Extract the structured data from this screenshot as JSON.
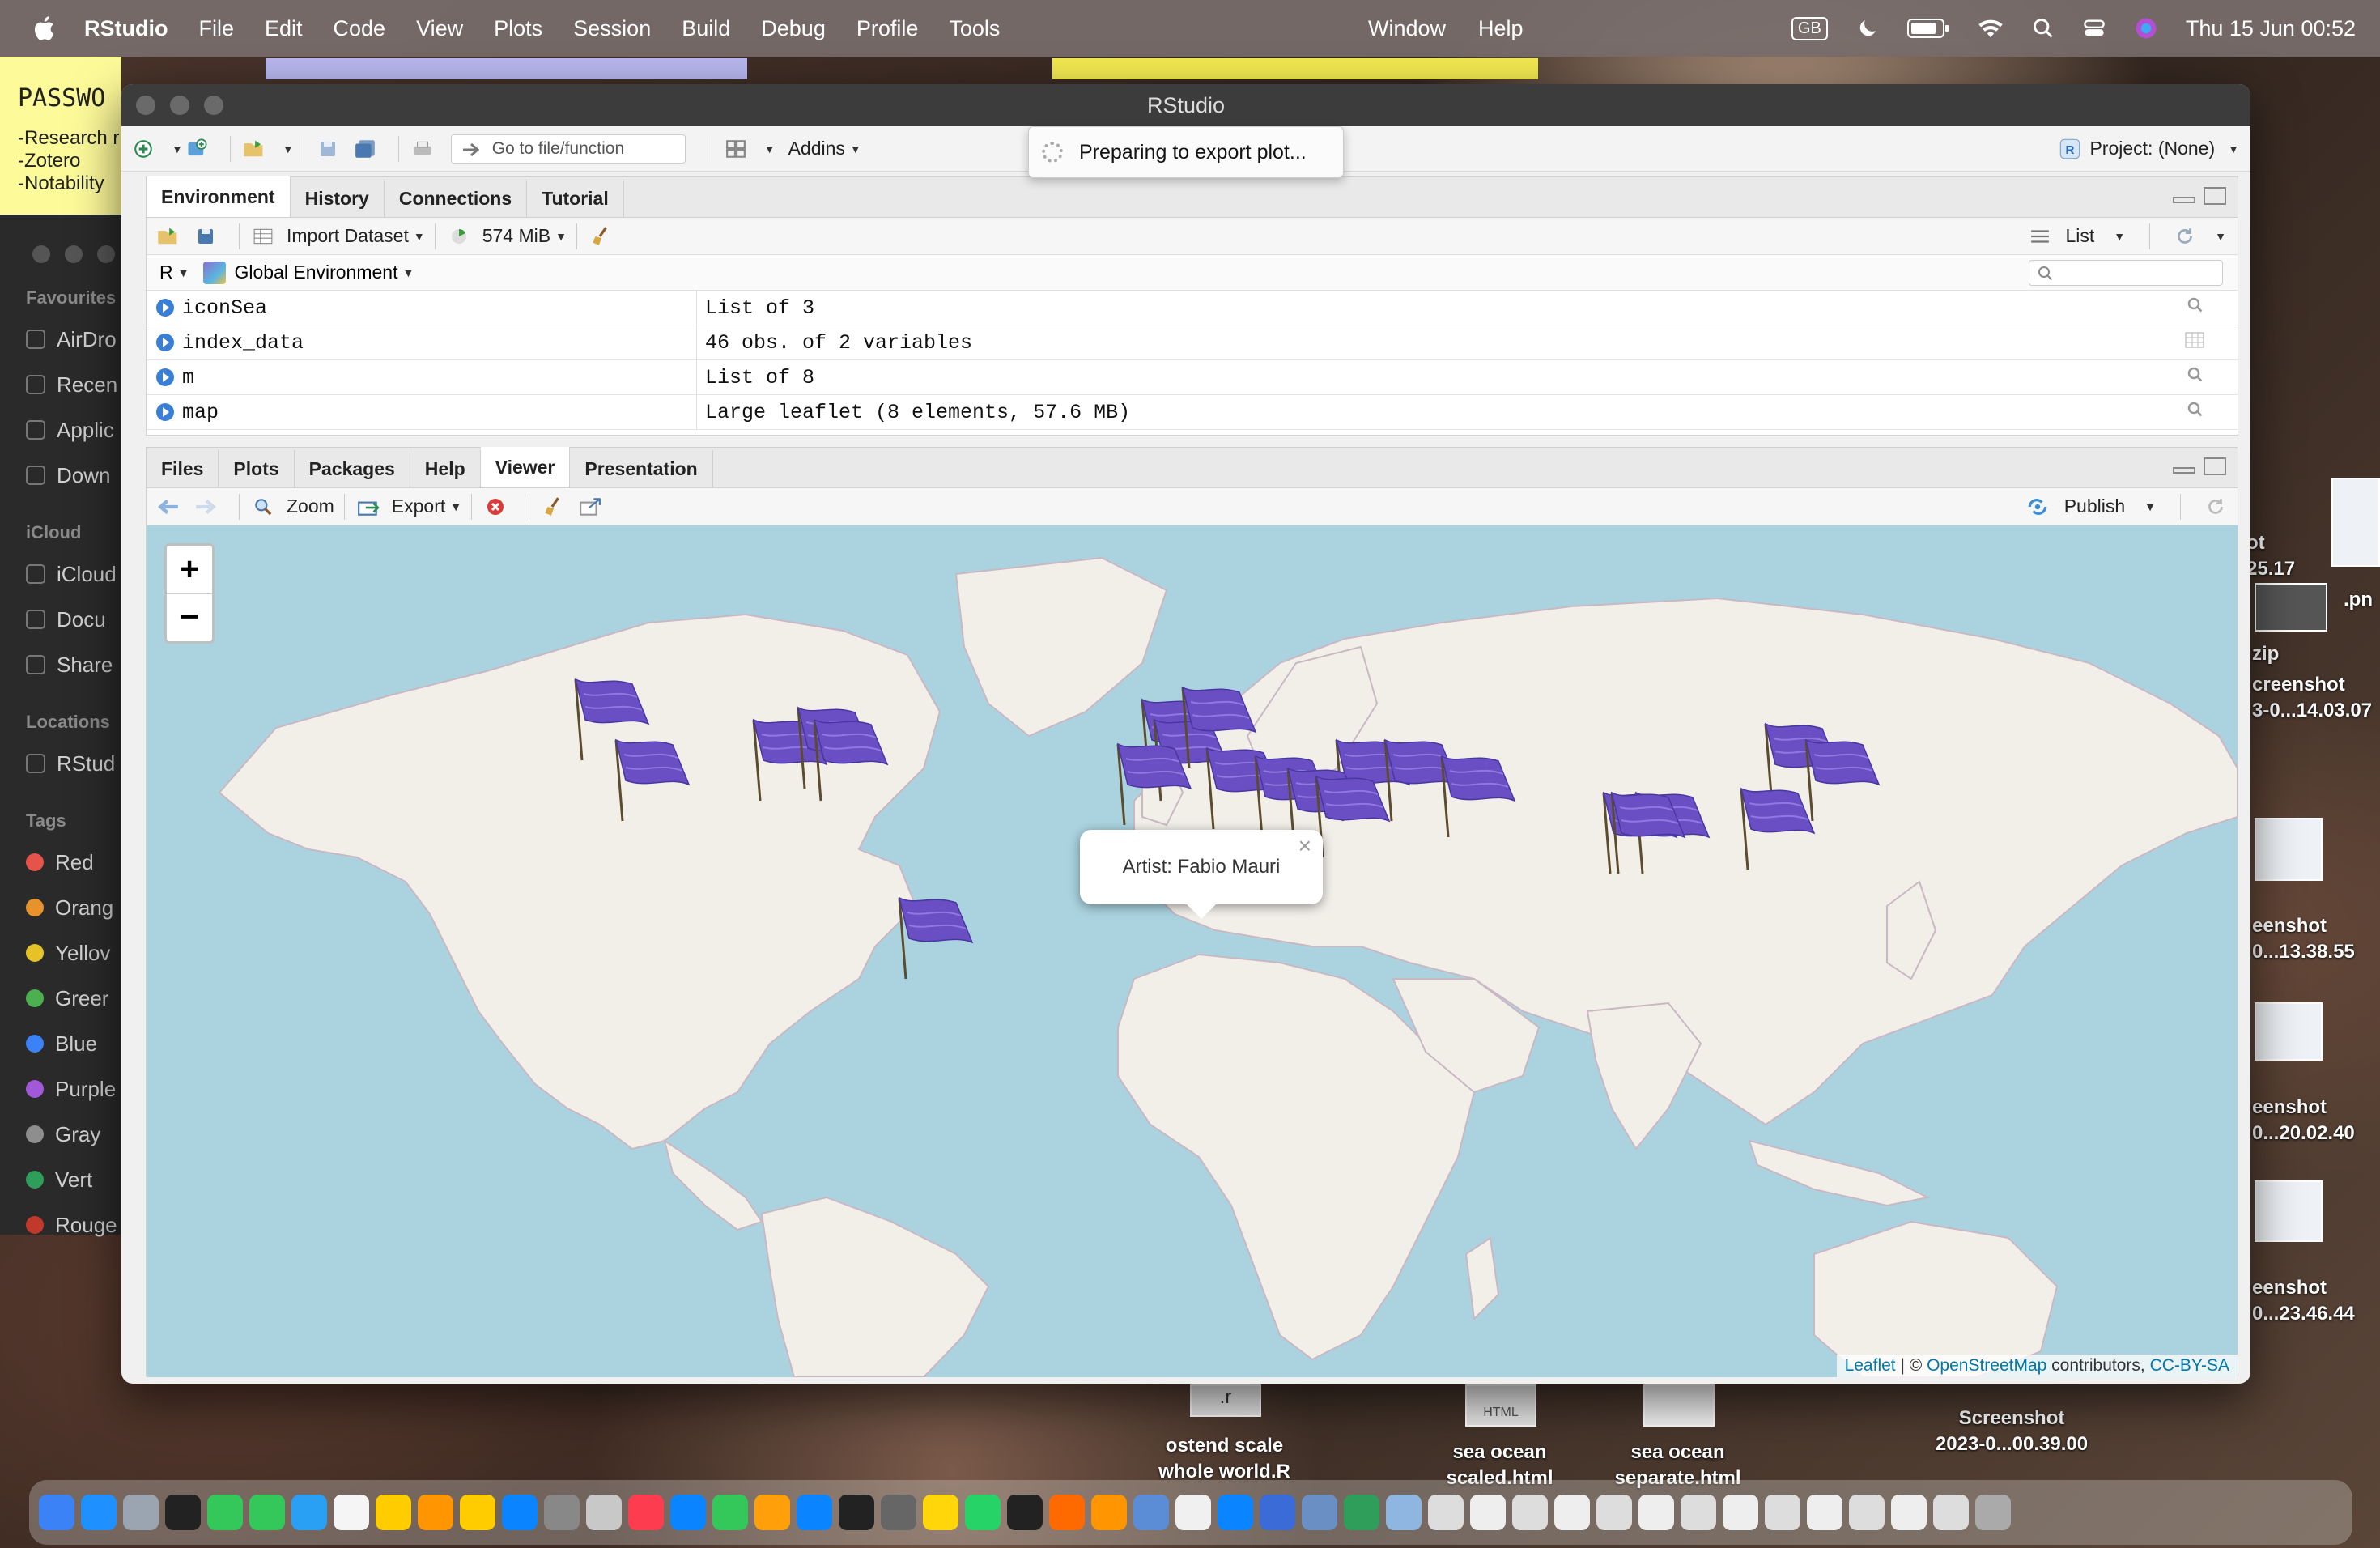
{
  "menubar": {
    "app": "RStudio",
    "items": [
      "File",
      "Edit",
      "Code",
      "View",
      "Plots",
      "Session",
      "Build",
      "Debug",
      "Profile",
      "Tools"
    ],
    "right_items": [
      "Window",
      "Help"
    ],
    "input_source": "GB",
    "datetime": "Thu 15 Jun  00:52"
  },
  "sticky": {
    "title": "PASSWO",
    "lines": [
      "-Research r",
      "-Zotero",
      "-Notability"
    ]
  },
  "finder": {
    "favourites_label": "Favourites",
    "favourites": [
      "AirDro",
      "Recen",
      "Applic",
      "Down"
    ],
    "icloud_label": "iCloud",
    "icloud": [
      "iCloud",
      "Docu",
      "Share"
    ],
    "locations_label": "Locations",
    "locations": [
      "RStud"
    ],
    "tags_label": "Tags",
    "tags": [
      {
        "label": "Red",
        "color": "#e5534b"
      },
      {
        "label": "Orang",
        "color": "#e8922e"
      },
      {
        "label": "Yellov",
        "color": "#e6c229"
      },
      {
        "label": "Greer",
        "color": "#4caf50"
      },
      {
        "label": "Blue",
        "color": "#3b82f6"
      },
      {
        "label": "Purple",
        "color": "#a259d9"
      },
      {
        "label": "Gray",
        "color": "#8e8e8e"
      },
      {
        "label": "Vert",
        "color": "#2e9e5a"
      },
      {
        "label": "Rouge",
        "color": "#c0392b"
      }
    ]
  },
  "desktop": {
    "right_labels": [
      {
        "l1": "ot",
        "l2": "25.17"
      },
      {
        "l1": "zip",
        "l2": ""
      },
      {
        "l1": "creenshot",
        "l2": "3-0...14.03.07"
      },
      {
        "l1": "eenshot",
        "l2": "0...13.38.55"
      },
      {
        "l1": "eenshot",
        "l2": "0...20.02.40"
      },
      {
        "l1": "eenshot",
        "l2": "0...23.46.44"
      },
      {
        "l1": ".pn",
        "l2": ""
      }
    ],
    "bottom_files": [
      {
        "badge": ".r",
        "l1": "ostend scale",
        "l2": "whole world.R"
      },
      {
        "badge": "HTML",
        "l1": "sea ocean",
        "l2": "scaled.html"
      },
      {
        "badge": "",
        "l1": "sea ocean",
        "l2": "separate.html"
      },
      {
        "badge": "",
        "l1": "Screenshot",
        "l2": "2023-0...00.39.00"
      }
    ]
  },
  "window": {
    "title": "RStudio"
  },
  "toolbar": {
    "goto_placeholder": "Go to file/function",
    "addins_label": "Addins",
    "project_label": "Project: (None)"
  },
  "export_popup": {
    "text": "Preparing to export plot..."
  },
  "env_pane": {
    "tabs": [
      "Environment",
      "History",
      "Connections",
      "Tutorial"
    ],
    "active_tab": "Environment",
    "import_label": "Import Dataset",
    "memory_label": "574 MiB",
    "list_label": "List",
    "language": "R",
    "scope": "Global Environment",
    "variables": [
      {
        "name": "iconSea",
        "value": "List of  3"
      },
      {
        "name": "index_data",
        "value": "46 obs. of 2 variables"
      },
      {
        "name": "m",
        "value": "List of  8"
      },
      {
        "name": "map",
        "value": "Large leaflet (8 elements,  57.6 MB)"
      }
    ]
  },
  "viewer_pane": {
    "tabs": [
      "Files",
      "Plots",
      "Packages",
      "Help",
      "Viewer",
      "Presentation"
    ],
    "active_tab": "Viewer",
    "zoom_label": "Zoom",
    "export_label": "Export",
    "publish_label": "Publish"
  },
  "map": {
    "zoom_in": "+",
    "zoom_out": "−",
    "popup_text": "Artist: Fabio Mauri",
    "popup_close": "×",
    "attribution": {
      "leaflet": "Leaflet",
      "sep": " | © ",
      "osm": "OpenStreetMap",
      "contrib": " contributors, ",
      "license": "CC-BY-SA"
    },
    "marker_color": "#6a4fc4",
    "land_color": "#f2efe9",
    "water_color": "#aad3df"
  }
}
